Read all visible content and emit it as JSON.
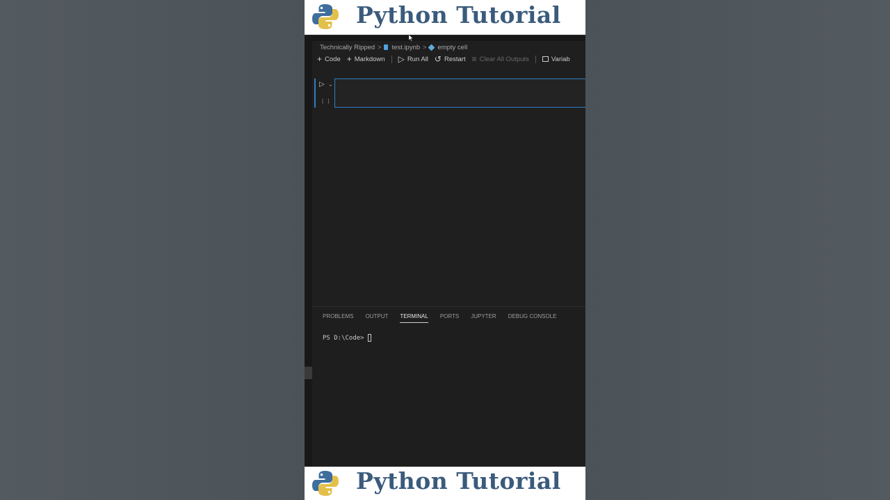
{
  "banner": {
    "title": "Python Tutorial",
    "logo_icon": "python-logo-icon"
  },
  "breadcrumb": {
    "items": [
      "Technically Ripped",
      "test.ipynb",
      "empty cell"
    ],
    "separator": ">"
  },
  "toolbar": {
    "code_label": "Code",
    "markdown_label": "Markdown",
    "run_all_label": "Run All",
    "restart_label": "Restart",
    "clear_outputs_label": "Clear All Outputs",
    "variables_label": "Variab"
  },
  "cell": {
    "execution_count": "[ ]",
    "accent_color": "#2f7fc1"
  },
  "panel": {
    "tabs": [
      "PROBLEMS",
      "OUTPUT",
      "TERMINAL",
      "PORTS",
      "JUPYTER",
      "DEBUG CONSOLE"
    ],
    "active_tab": "TERMINAL"
  },
  "terminal": {
    "prompt": "PS D:\\Code>"
  },
  "colors": {
    "banner_title": "#3b5b7c",
    "editor_bg": "#1f1f1f",
    "side_bg": "#4f575d"
  }
}
